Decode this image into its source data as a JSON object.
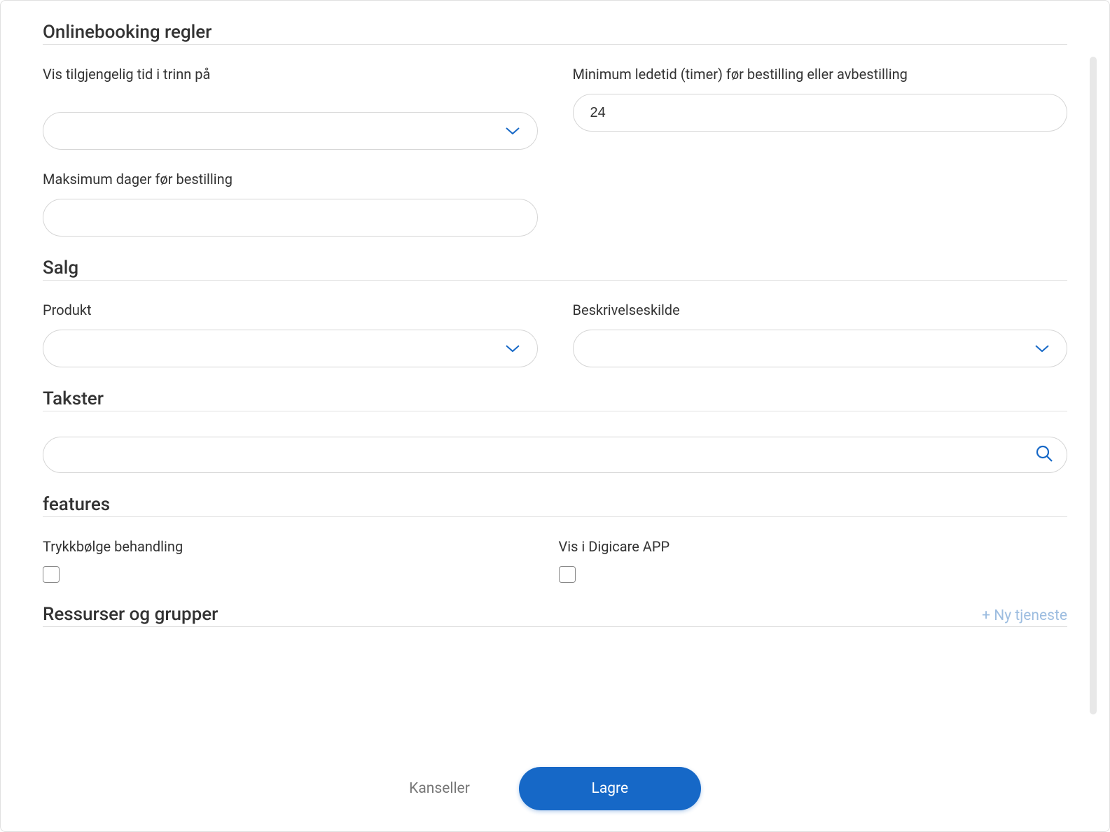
{
  "sections": {
    "onlinebooking": {
      "title": "Onlinebooking regler",
      "fields": {
        "time_step_label": "Vis tilgjengelig tid i trinn på",
        "time_step_value": "",
        "lead_time_label": "Minimum ledetid (timer) før bestilling eller avbestilling",
        "lead_time_value": "24",
        "max_days_label": "Maksimum dager før bestilling",
        "max_days_value": ""
      }
    },
    "salg": {
      "title": "Salg",
      "fields": {
        "product_label": "Produkt",
        "product_value": "",
        "description_source_label": "Beskrivelseskilde",
        "description_source_value": ""
      }
    },
    "takster": {
      "title": "Takster",
      "search_value": ""
    },
    "features": {
      "title": "features",
      "fields": {
        "shockwave_label": "Trykkbølge behandling",
        "shockwave_checked": false,
        "digicare_label": "Vis i Digicare APP",
        "digicare_checked": false
      }
    },
    "resources": {
      "title": "Ressurser og grupper",
      "new_service_link": "+ Ny tjeneste"
    }
  },
  "footer": {
    "cancel": "Kanseller",
    "save": "Lagre"
  }
}
